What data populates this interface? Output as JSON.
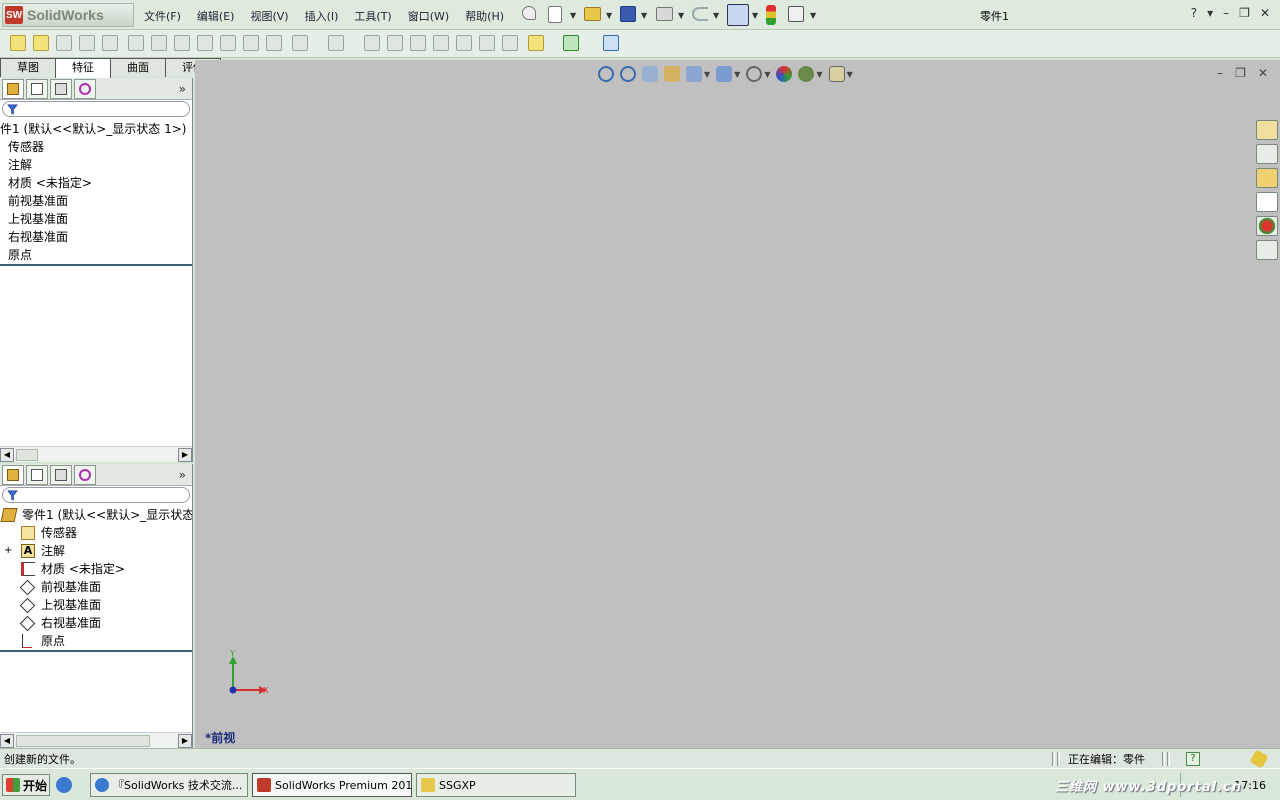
{
  "app": {
    "brand": "SolidWorks",
    "logo_badge": "SW",
    "document_title": "零件1",
    "window_controls": [
      "?",
      "▾",
      "–",
      "❐",
      "✕"
    ]
  },
  "menu": {
    "items": [
      "文件(F)",
      "编辑(E)",
      "视图(V)",
      "插入(I)",
      "工具(T)",
      "窗口(W)",
      "帮助(H)"
    ]
  },
  "command_manager": {
    "tabs": [
      "草图",
      "特征",
      "曲面",
      "评估"
    ],
    "active_tab": "特征"
  },
  "feature_tree_top": {
    "expand_label": "»",
    "root": "件1 (默认<<默认>_显示状态 1>)",
    "items": [
      "传感器",
      "注解",
      "材质 <未指定>",
      "前视基准面",
      "上视基准面",
      "右视基准面",
      "原点"
    ]
  },
  "feature_tree_bottom": {
    "expand_label": "»",
    "root": "零件1 (默认<<默认>_显示状态",
    "expander": "+",
    "annotation_glyph": "A",
    "items": [
      "传感器",
      "注解",
      "材质 <未指定>",
      "前视基准面",
      "上视基准面",
      "右视基准面",
      "原点"
    ]
  },
  "graphics": {
    "view_name": "*前视",
    "triad": {
      "y_label": "Y",
      "x_label": "X"
    },
    "background": "#c0c0c0",
    "window_controls": [
      "–",
      "❐",
      "✕"
    ]
  },
  "status_bar": {
    "message": "创建新的文件。",
    "editing": "正在编辑：零件",
    "help": "?"
  },
  "taskbar": {
    "start": "开始",
    "tasks": [
      "『SolidWorks 技术交流...",
      "SolidWorks Premium 201...",
      "SSGXP"
    ],
    "clock": "17:16"
  },
  "watermark": "三维网 www.3dportal.cn",
  "colors": {
    "ui_bg": "#dfeadf",
    "tree_separator": "#3b5d7a",
    "axis_x": "#d03030",
    "axis_y": "#30a030",
    "view_name": "#1a2a7a"
  }
}
